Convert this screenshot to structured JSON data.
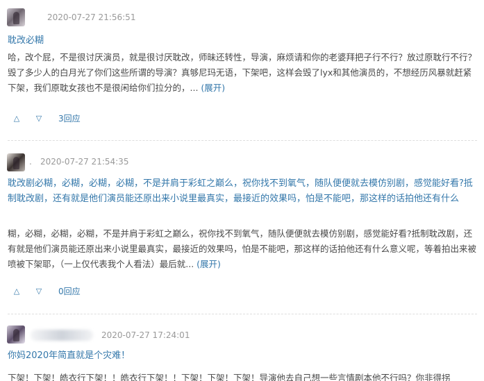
{
  "reviews": [
    {
      "timestamp": "2020-07-27 21:56:51",
      "username": "",
      "title": "耽改必糊",
      "body": "哈，改个屁，不是很讨厌演员，就是很讨厌耽改，师昧还转性，导演，麻烦请和你的老婆拜把子行不行？放过原耽行不行？毁了多少人的白月光了你们这些所谓的导演？真够尼玛无语，下架吧，这样会毁了lyx和其他演员的，不想经历风暴就赶紧下架，我们原耽女孩也不是很闲给你们拉分的，... ",
      "expand_label": "(展开)",
      "reply_count": "3回应",
      "up_icon": "triangle-up-icon",
      "down_icon": "triangle-down-icon"
    },
    {
      "timestamp": "2020-07-27 21:54:35",
      "username": ".",
      "title": "耽改剧必糊，必糊，必糊，必糊，不是并肩于彩虹之巅么，祝你找不到氧气，随队便便就去模仿别剧，感觉能好看?抵制耽改剧，还有就是他们演员能还原出来小说里最真实，最接近的效果吗，怕是不能吧，那这样的话拍他还有什么",
      "body": "糊，必糊，必糊，必糊，不是并肩于彩虹之巅么，祝你找不到氧气，随队便便就去模仿别剧，感觉能好看?抵制耽改剧，还有就是他们演员能还原出来小说里最真实，最接近的效果吗，怕是不能吧，那这样的话拍他还有什么意义呢，等着拍出来被喷被下架耶，（一上仅代表我个人看法）最后就... ",
      "expand_label": "(展开)",
      "reply_count": "0回应",
      "up_icon": "triangle-up-icon",
      "down_icon": "triangle-down-icon"
    },
    {
      "timestamp": "2020-07-27 17:24:01",
      "username": "",
      "title": "你妈2020年简直就是个灾难！",
      "body": "下架！下架！皓衣行下架！！皓衣行下架！！下架！下架！下架！导演他去自己想一些言情剧本他不行吗？你非得拐"
    }
  ]
}
